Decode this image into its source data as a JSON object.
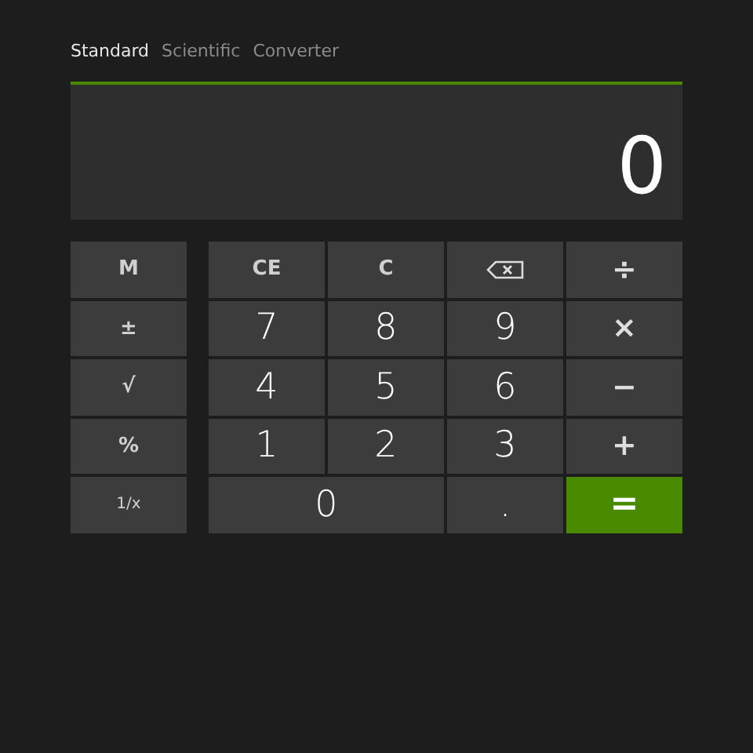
{
  "tabs": [
    {
      "label": "Standard",
      "selected": true
    },
    {
      "label": "Scientific",
      "selected": false
    },
    {
      "label": "Converter",
      "selected": false
    }
  ],
  "display": {
    "value": "0"
  },
  "memory_keys": [
    {
      "label": "M",
      "kind": "func"
    },
    {
      "label": "±",
      "kind": "func"
    },
    {
      "label": "√",
      "kind": "func"
    },
    {
      "label": "%",
      "kind": "func"
    },
    {
      "label": "1/x",
      "kind": "small"
    }
  ],
  "keys": [
    {
      "label": "CE",
      "kind": "func",
      "wide": false
    },
    {
      "label": "C",
      "kind": "func",
      "wide": false
    },
    {
      "kind": "backspace",
      "wide": false
    },
    {
      "label": "÷",
      "kind": "op",
      "wide": false
    },
    {
      "label": "7",
      "kind": "digit",
      "wide": false
    },
    {
      "label": "8",
      "kind": "digit",
      "wide": false
    },
    {
      "label": "9",
      "kind": "digit",
      "wide": false
    },
    {
      "label": "×",
      "kind": "op",
      "wide": false
    },
    {
      "label": "4",
      "kind": "digit",
      "wide": false
    },
    {
      "label": "5",
      "kind": "digit",
      "wide": false
    },
    {
      "label": "6",
      "kind": "digit",
      "wide": false
    },
    {
      "label": "−",
      "kind": "op",
      "wide": false
    },
    {
      "label": "1",
      "kind": "digit",
      "wide": false
    },
    {
      "label": "2",
      "kind": "digit",
      "wide": false
    },
    {
      "label": "3",
      "kind": "digit",
      "wide": false
    },
    {
      "label": "+",
      "kind": "op",
      "wide": false
    },
    {
      "label": "0",
      "kind": "digit",
      "wide": true
    },
    {
      "label": ".",
      "kind": "digit",
      "wide": false
    },
    {
      "label": "=",
      "kind": "equals",
      "wide": false
    }
  ]
}
